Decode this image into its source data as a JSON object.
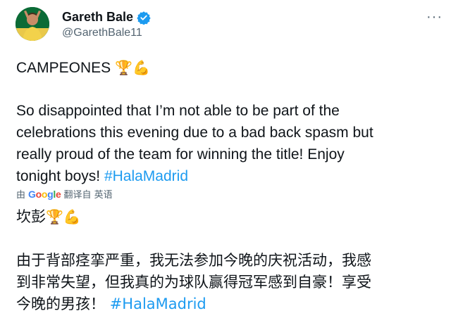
{
  "author": {
    "name": "Gareth Bale",
    "handle": "@GarethBale11",
    "verified": true
  },
  "header": {
    "more_label": "···"
  },
  "tweet": {
    "headline": "CAMPEONES",
    "headline_emoji": [
      "trophy-icon",
      "flexed-biceps-icon"
    ],
    "body_lines": [
      "So disappointed that I’m not able to be part of the",
      "celebrations this evening due to a bad back spasm but",
      "really proud of the team for winning the title! Enjoy",
      "tonight boys!"
    ],
    "hashtag": "#HalaMadrid"
  },
  "translation": {
    "by_prefix": "由",
    "google_letters": [
      "G",
      "o",
      "o",
      "g",
      "l",
      "e"
    ],
    "action": "翻译自 英语",
    "headline": "坎彭",
    "body_lines": [
      "由于背部痉挛严重，我无法参加今晚的庆祝活动，我感",
      "到非常失望，但我真的为球队赢得冠军感到自豪！享受",
      "今晚的男孩！"
    ],
    "hashtag": "#HalaMadrid"
  },
  "colors": {
    "link": "#1d9bf0",
    "verified_badge": "#1d9bf0",
    "secondary_text": "#536471",
    "google_blue": "#4285f4",
    "google_red": "#ea4335",
    "google_yellow": "#fbbc05",
    "google_green": "#34a853"
  }
}
